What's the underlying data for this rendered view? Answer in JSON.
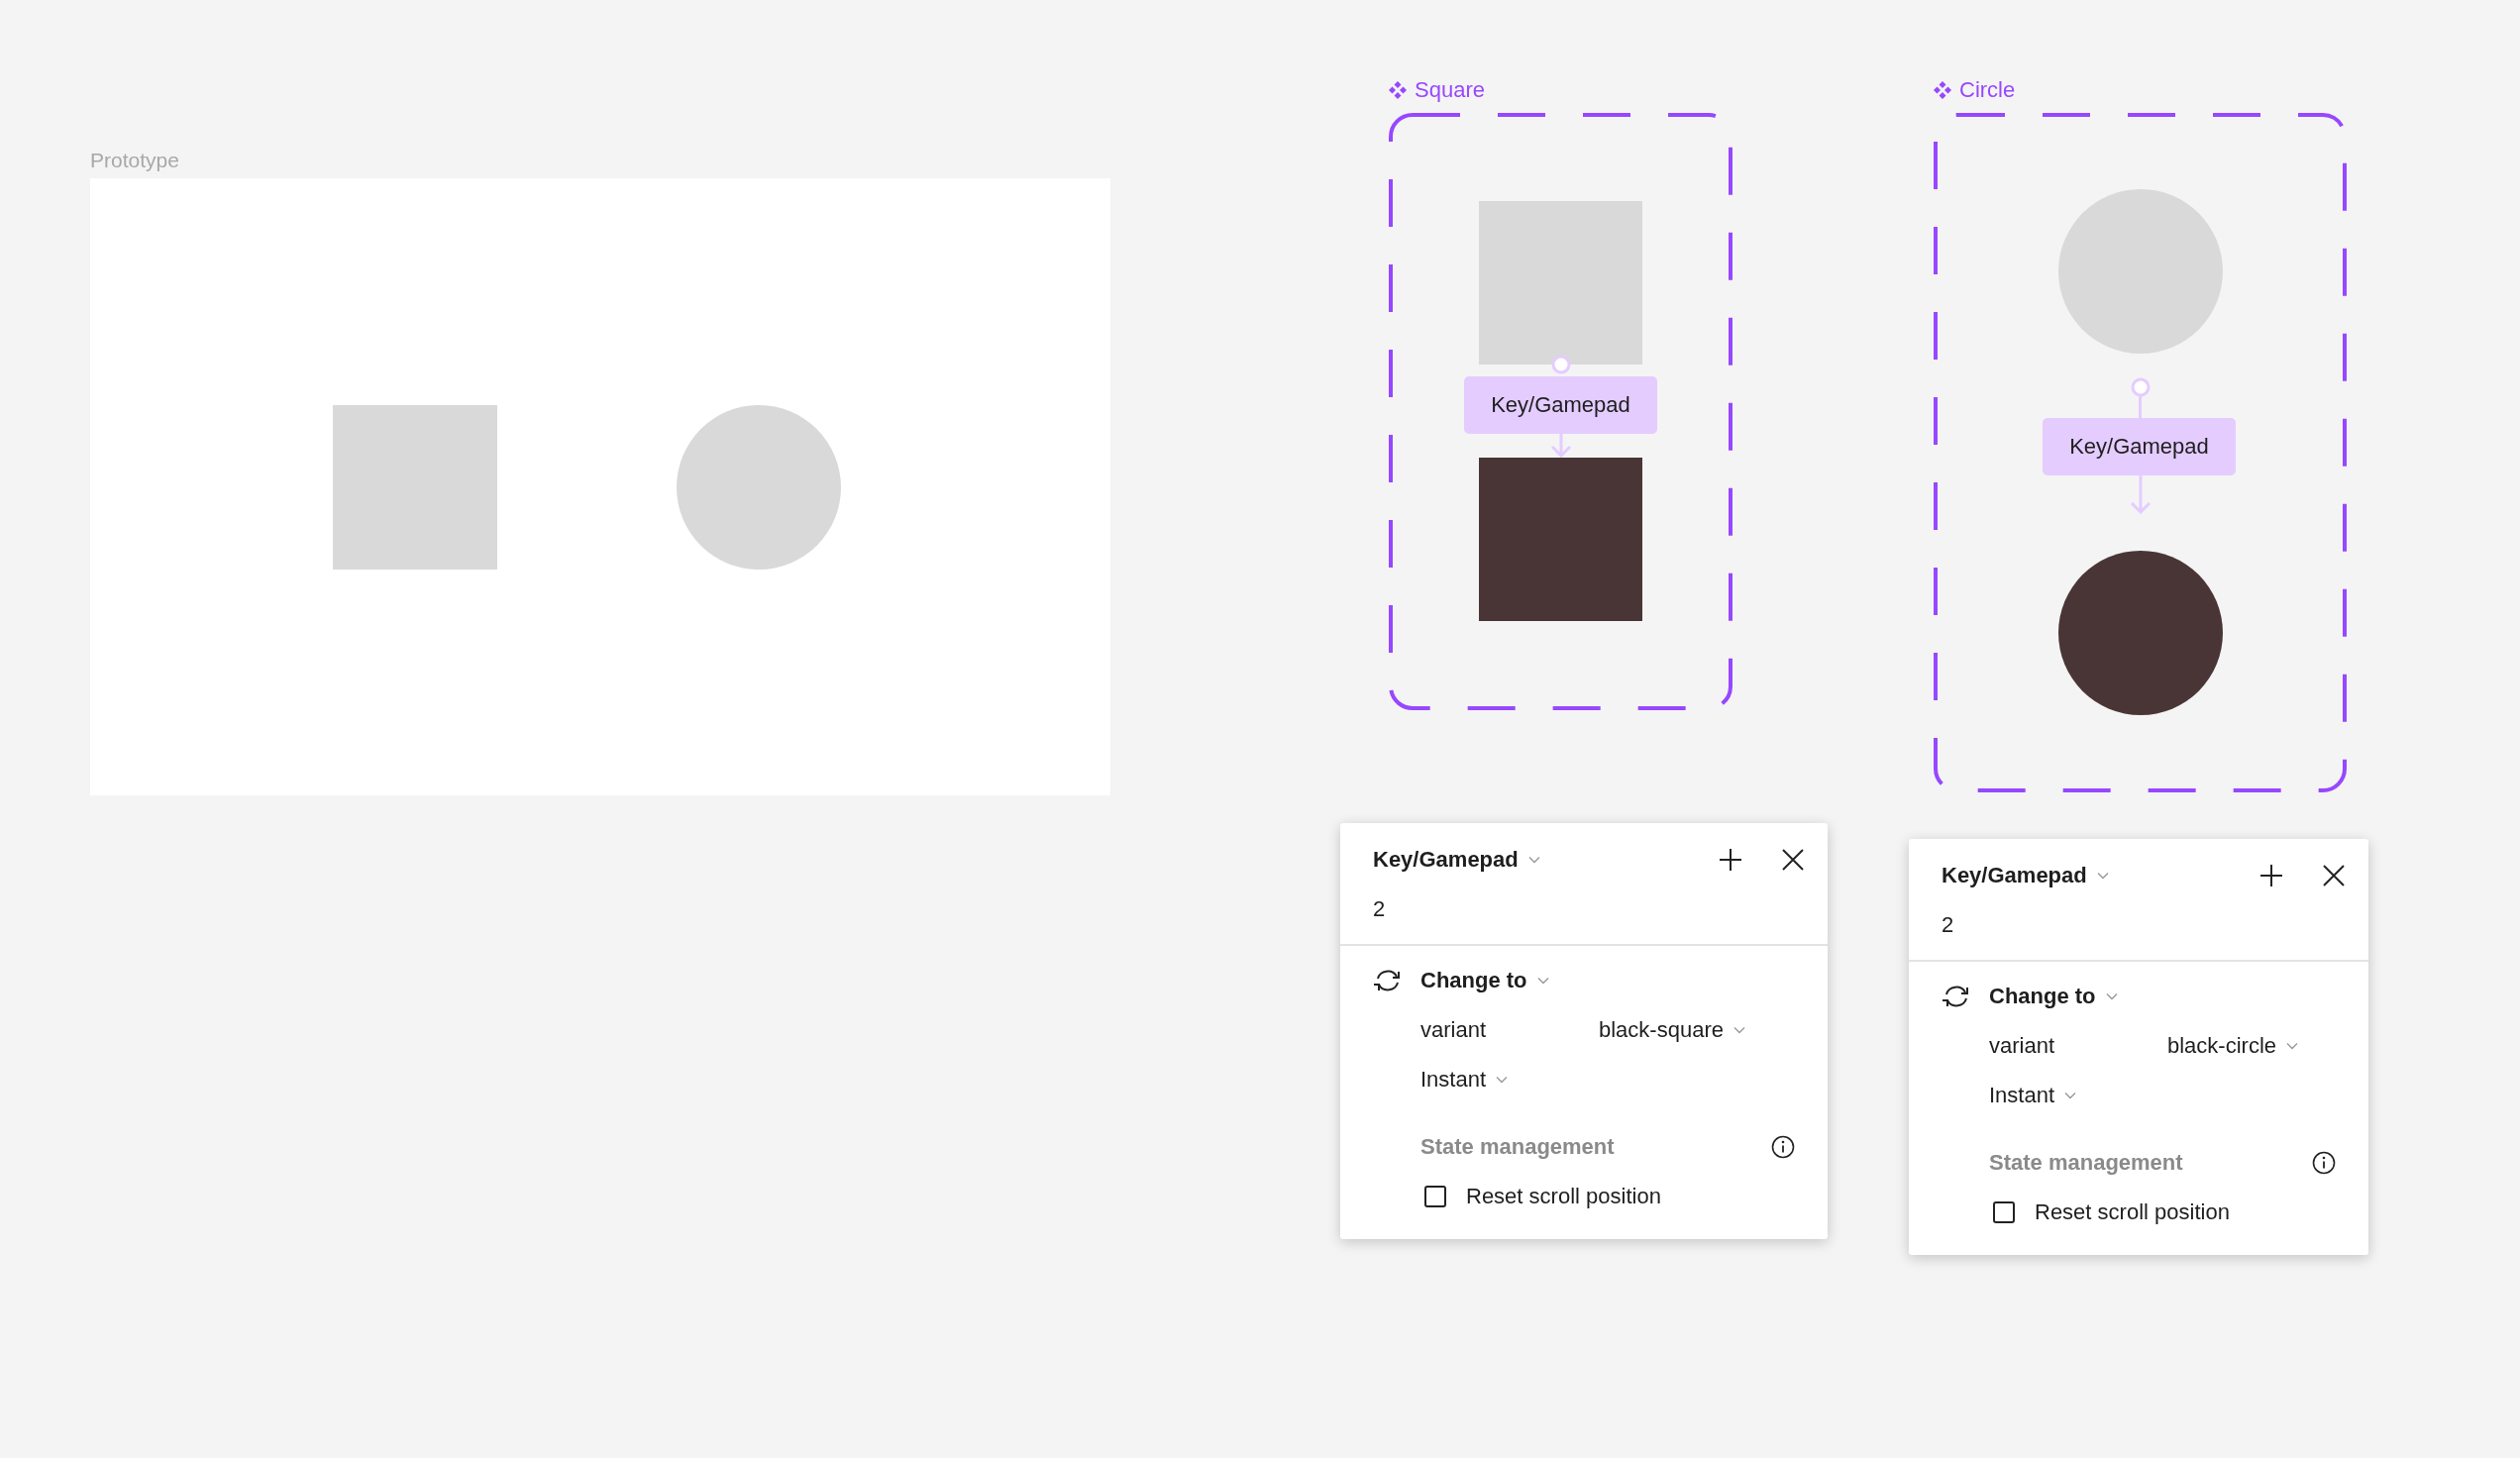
{
  "canvas": {
    "prototype_frame": {
      "label": "Prototype",
      "shapes": [
        {
          "kind": "square"
        },
        {
          "kind": "circle"
        }
      ]
    },
    "component_sets": [
      {
        "name": "Square",
        "kind": "square",
        "trigger": "Key/Gamepad"
      },
      {
        "name": "Circle",
        "kind": "circle",
        "trigger": "Key/Gamepad"
      }
    ],
    "interaction_panels": [
      {
        "trigger": "Key/Gamepad",
        "key": "2",
        "action": "Change to",
        "property": "variant",
        "value": "black-square",
        "animation": "Instant",
        "section": "State management",
        "option": {
          "label": "Reset scroll position",
          "checked": false
        }
      },
      {
        "trigger": "Key/Gamepad",
        "key": "2",
        "action": "Change to",
        "property": "variant",
        "value": "black-circle",
        "animation": "Instant",
        "section": "State management",
        "option": {
          "label": "Reset scroll position",
          "checked": false
        }
      }
    ]
  }
}
